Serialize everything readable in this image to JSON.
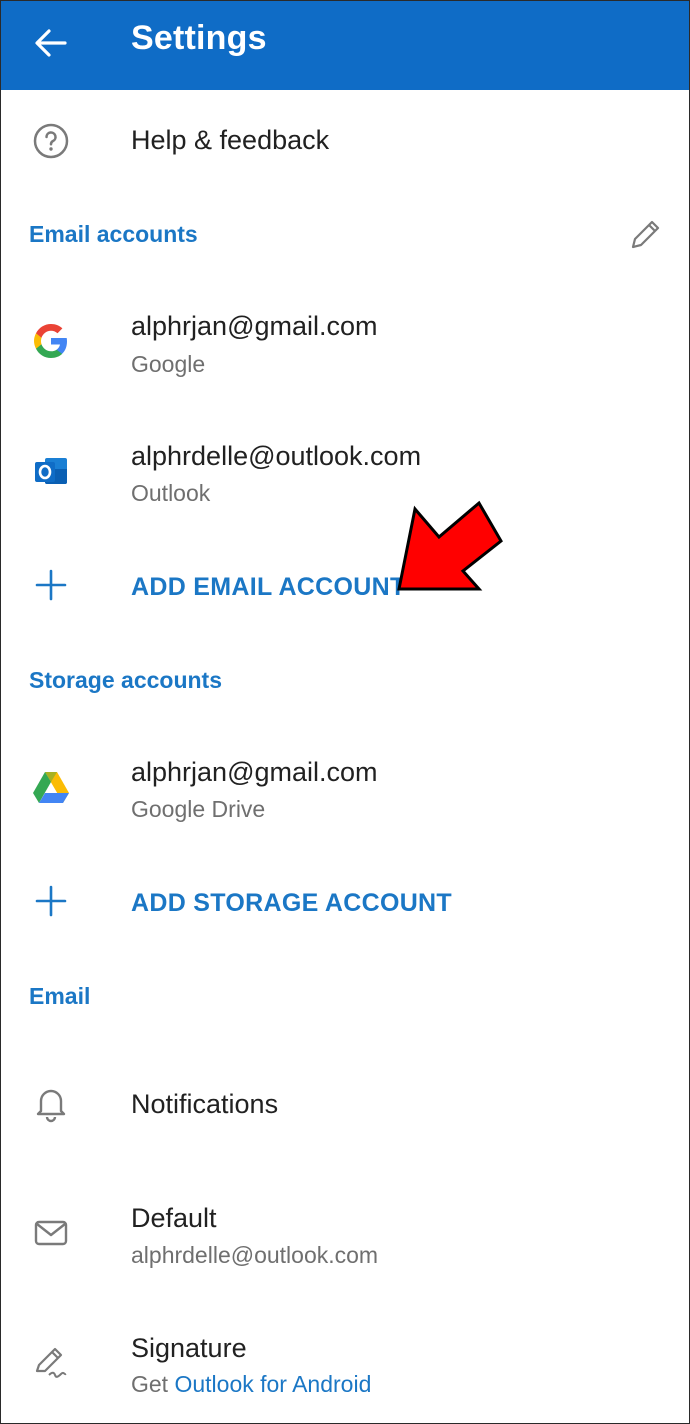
{
  "header": {
    "title": "Settings"
  },
  "help": {
    "label": "Help & feedback"
  },
  "email_accounts": {
    "section_label": "Email accounts",
    "accounts": [
      {
        "email": "alphrjan@gmail.com",
        "provider": "Google"
      },
      {
        "email": "alphrdelle@outlook.com",
        "provider": "Outlook"
      }
    ],
    "add_label": "ADD EMAIL ACCOUNT"
  },
  "storage_accounts": {
    "section_label": "Storage accounts",
    "accounts": [
      {
        "email": "alphrjan@gmail.com",
        "provider": "Google Drive"
      }
    ],
    "add_label": "ADD STORAGE ACCOUNT"
  },
  "email": {
    "section_label": "Email",
    "notifications_label": "Notifications",
    "default": {
      "label": "Default",
      "value": "alphrdelle@outlook.com"
    },
    "signature": {
      "label": "Signature",
      "prefix": "Get",
      "link_text": "Outlook for Android"
    }
  },
  "colors": {
    "accent": "#0f6cc6",
    "link": "#1b77c5",
    "annotation_arrow": "#ff0000"
  },
  "icons": [
    "back-arrow-icon",
    "help-icon",
    "pencil-icon",
    "google-icon",
    "outlook-icon",
    "plus-icon",
    "google-drive-icon",
    "bell-icon",
    "envelope-icon",
    "signature-icon"
  ]
}
